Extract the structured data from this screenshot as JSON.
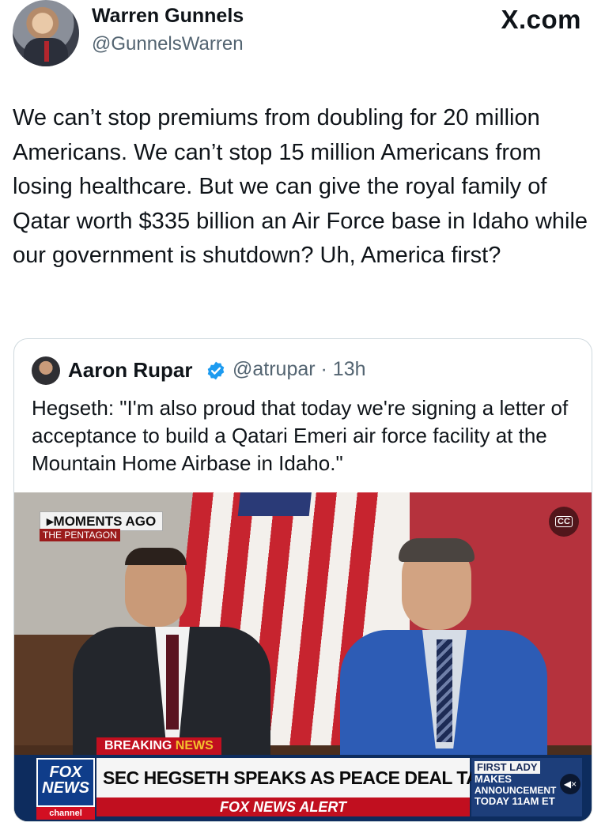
{
  "header": {
    "display_name": "Warren Gunnels",
    "handle": "@GunnelsWarren",
    "site_label": "X.com"
  },
  "tweet": {
    "text": "We can’t stop premiums from doubling for 20 million Americans. We can’t stop 15 million Americans from losing healthcare. But we can give the royal family of Qatar worth $335 billion an Air Force base in Idaho while our government is shutdown? Uh, America first?"
  },
  "quote": {
    "display_name": "Aaron Rupar",
    "handle_time": "@atrupar · 13h",
    "text": "Hegseth: \"I'm also proud that today we're signing a letter of acceptance to build a Qatari Emeri air force facility at the Mountain Home Airbase in Idaho.\"",
    "video": {
      "moments_ago": "▸MOMENTS AGO",
      "location_tag": "THE PENTAGON",
      "cc_label": "CC",
      "breaking_prefix": "BREAKING ",
      "breaking_suffix": "NEWS",
      "logo_line1": "FOX",
      "logo_line2": "NEWS",
      "logo_channel": "channel",
      "headline": "SEC HEGSETH SPEAKS AS PEACE DEAL TAKES HOLD",
      "alert": "FOX NEWS ALERT",
      "promo_line1": "FIRST LADY",
      "promo_line2": "MAKES",
      "promo_line3": "ANNOUNCEMENT",
      "promo_line4": "TODAY 11AM ET"
    }
  },
  "colors": {
    "text_primary": "#0f1419",
    "text_secondary": "#536471",
    "verified_blue": "#1d9bf0",
    "border": "#cfd9de",
    "fox_red": "#c10f1f",
    "fox_blue": "#0d2c5e"
  }
}
